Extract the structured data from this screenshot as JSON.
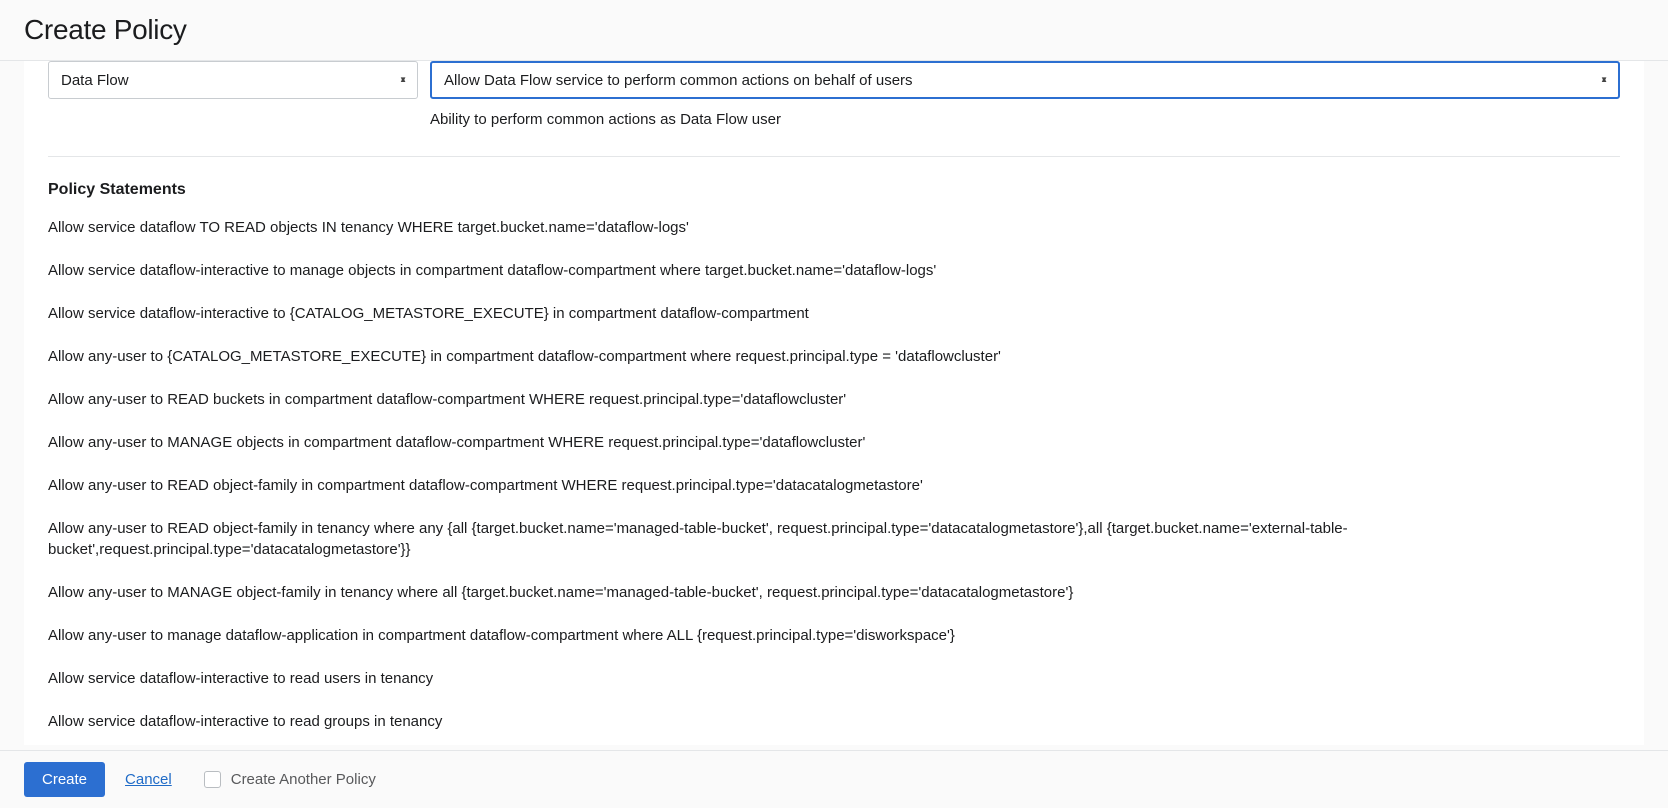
{
  "header": {
    "title": "Create Policy"
  },
  "selects": {
    "service": "Data Flow",
    "use_case": "Allow Data Flow service to perform common actions on behalf of users",
    "helper": "Ability to perform common actions as Data Flow user"
  },
  "section": {
    "heading": "Policy Statements"
  },
  "statements": [
    "Allow service dataflow TO READ objects IN tenancy WHERE target.bucket.name='dataflow-logs'",
    "Allow service dataflow-interactive to manage objects in compartment dataflow-compartment where target.bucket.name='dataflow-logs'",
    "Allow service dataflow-interactive to {CATALOG_METASTORE_EXECUTE} in compartment dataflow-compartment",
    "Allow any-user to {CATALOG_METASTORE_EXECUTE} in compartment dataflow-compartment where request.principal.type = 'dataflowcluster'",
    "Allow any-user to READ buckets in compartment dataflow-compartment WHERE request.principal.type='dataflowcluster'",
    "Allow any-user to MANAGE objects in compartment dataflow-compartment WHERE request.principal.type='dataflowcluster'",
    "Allow any-user to READ object-family in compartment dataflow-compartment WHERE request.principal.type='datacatalogmetastore'",
    "Allow any-user to READ object-family in tenancy where any {all {target.bucket.name='managed-table-bucket', request.principal.type='datacatalogmetastore'},all {target.bucket.name='external-table-bucket',request.principal.type='datacatalogmetastore'}}",
    "Allow any-user to MANAGE object-family in tenancy where all {target.bucket.name='managed-table-bucket', request.principal.type='datacatalogmetastore'}",
    "Allow any-user to manage dataflow-application in compartment dataflow-compartment where ALL {request.principal.type='disworkspace'}",
    "Allow service dataflow-interactive to read users in tenancy",
    "Allow service dataflow-interactive to read groups in tenancy"
  ],
  "footer": {
    "create_label": "Create",
    "cancel_label": "Cancel",
    "another_label": "Create Another Policy"
  }
}
